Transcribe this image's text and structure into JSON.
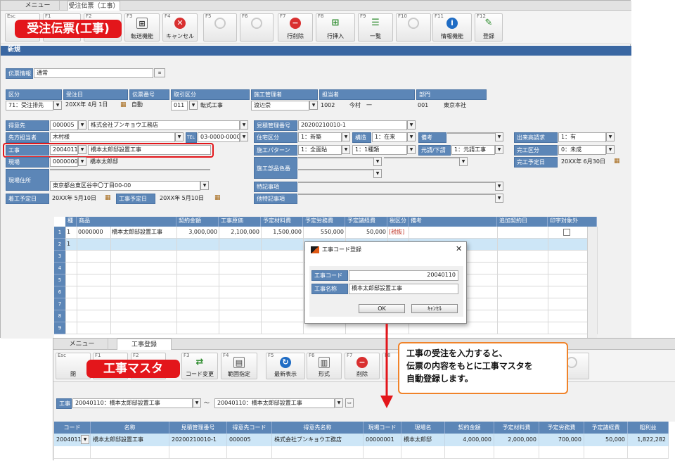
{
  "window1": {
    "tabs": [
      "メニュー",
      "受注伝票（工事）"
    ],
    "title_badge": "受注伝票(工事)",
    "toolbar": [
      {
        "fk": "Esc",
        "label": ""
      },
      {
        "fk": "F1",
        "label": ""
      },
      {
        "fk": "F2",
        "label": ""
      },
      {
        "fk": "F3",
        "label": "転送機能",
        "icon": "transfer-icon"
      },
      {
        "fk": "F4",
        "label": "キャンセル",
        "icon": "cancel-icon"
      },
      {
        "fk": "F5",
        "label": "",
        "icon": "disabled-icon"
      },
      {
        "fk": "F6",
        "label": "",
        "icon": "disabled-icon"
      },
      {
        "fk": "F7",
        "label": "行削除",
        "icon": "delete-row-icon"
      },
      {
        "fk": "F8",
        "label": "行挿入",
        "icon": "insert-row-icon"
      },
      {
        "fk": "F9",
        "label": "一覧",
        "icon": "list-icon"
      },
      {
        "fk": "F10",
        "label": "",
        "icon": "disabled-icon"
      },
      {
        "fk": "F11",
        "label": "情報機能",
        "icon": "info-icon"
      },
      {
        "fk": "F12",
        "label": "登録",
        "icon": "register-icon"
      }
    ],
    "mode": "新規",
    "slip_info_label": "伝票情報",
    "slip_info_value": "通常",
    "header": {
      "labels": [
        "区分",
        "受注日",
        "伝票番号",
        "取引区分",
        "施工管理者",
        "担当者",
        "部門"
      ],
      "classification": "71：受注排先",
      "order_date": "20XX年 4月 1日",
      "slip_no": "自動",
      "trade_code": "011",
      "trade_name": "転式工事",
      "construction_manager": "渡辺崇",
      "staff_code": "1002",
      "staff_name": "今村　一",
      "dept_code": "001",
      "dept_name": "東京本社"
    },
    "form": {
      "customer_label": "得意先",
      "customer_code": "000005",
      "customer_name": "株式会社ブンキョウ工務店",
      "contact_label": "先方担当者",
      "contact_value": "木村様",
      "tel_label": "TEL",
      "tel_value": "03-0000-0000",
      "work_label": "工事",
      "work_code": "20040111",
      "work_name": "橋本太郎邸設置工事",
      "site_label": "現場",
      "site_code": "00000001",
      "site_name": "橋本太郎邸",
      "address_label": "現場住所",
      "address_line2": "東京都台東区谷中〇丁目00-00",
      "start_label": "着工予定日",
      "start_date": "20XX年 5月10日",
      "end_label": "工事予定日",
      "end_date": "20XX年 5月10日",
      "estimate_no_label": "見積管理番号",
      "estimate_no": "20200210010-1",
      "housing_label": "住宅区分",
      "housing_value": "1：新築",
      "structure_label": "構造",
      "structure_value": "1：在来",
      "remarks_label": "備考",
      "pattern_label": "施工パターン",
      "pattern_value": "1：全面貼",
      "pattern2_value": "1：1種類",
      "original_label": "元請/下請",
      "original_value": "1：元請工事",
      "parts_label": "施工部品色番",
      "special_label": "特記事項",
      "other_label": "他特記事項",
      "height_label": "出来高請求",
      "height_value": "1：有",
      "done_label": "完工区分",
      "done_value": "0：未成",
      "done_date_label": "完工予定日",
      "done_date_value": "20XX年 6月30日"
    },
    "grid": {
      "headers": [
        "種",
        "商品",
        "",
        "契約金額",
        "工事原価",
        "予定材料費",
        "予定労務費",
        "予定諸経費",
        "税区分",
        "備考",
        "追加契約日",
        "印字対象外"
      ],
      "rows": [
        {
          "no": "1",
          "kind": "1",
          "code": "0000000",
          "name": "橋本太郎邸設置工事",
          "contract": "3,000,000",
          "cost": "2,100,000",
          "material": "1,500,000",
          "labor": "550,000",
          "expense": "50,000",
          "tax": "[税抜]"
        },
        {
          "no": "2",
          "kind": "1"
        },
        {
          "no": "3"
        },
        {
          "no": "4"
        },
        {
          "no": "5"
        },
        {
          "no": "6"
        },
        {
          "no": "7"
        },
        {
          "no": "8"
        },
        {
          "no": "9"
        }
      ]
    }
  },
  "dialog": {
    "title": "工事コード登録",
    "code_label": "工事コード",
    "code_value": "20040110",
    "name_label": "工事名称",
    "name_value": "橋本太郎邸設置工事",
    "ok": "OK",
    "cancel": "ｷｬﾝｾﾙ"
  },
  "window2": {
    "tabs": [
      "メニュー",
      "工事登録"
    ],
    "title_badge": "工事マスタ",
    "toolbar": [
      {
        "fk": "Esc",
        "label": "閉"
      },
      {
        "fk": "F1",
        "label": ""
      },
      {
        "fk": "F2",
        "label": ""
      },
      {
        "fk": "F3",
        "label": "コード変更"
      },
      {
        "fk": "F4",
        "label": "範囲指定"
      },
      {
        "fk": "F5",
        "label": "最新表示"
      },
      {
        "fk": "F6",
        "label": "形式"
      },
      {
        "fk": "F7",
        "label": "削除"
      },
      {
        "fk": "F8",
        "label": ""
      }
    ],
    "filter_label": "工事",
    "filter_from": "20040110：橋本太郎邸設置工事",
    "tilde": "～",
    "filter_to": "20040110：橋本太郎邸設置工事",
    "headers": [
      "コード",
      "名称",
      "見積管理番号",
      "得意先コード",
      "得意先名称",
      "現場コード",
      "現場名",
      "契約金額",
      "予定材料費",
      "予定労務費",
      "予定諸経費",
      "粗利益"
    ],
    "row": [
      "20040110",
      "橋本太郎邸設置工事",
      "20200210010-1",
      "000005",
      "株式会社ブンキョウ工務店",
      "00000001",
      "橋本太郎邸",
      "4,000,000",
      "2,000,000",
      "700,000",
      "50,000",
      "1,822,282"
    ]
  },
  "callout": {
    "line1": "工事の受注を入力すると、",
    "line2": "伝票の内容をもとに工事マスタを",
    "line3": "自動登録します。"
  },
  "colors": {
    "accent_red": "#e3161b",
    "header_blue": "#5c86b7",
    "bar_blue": "#3a67a2",
    "callout_orange": "#f0832a",
    "selected_row": "#cde6f7"
  }
}
